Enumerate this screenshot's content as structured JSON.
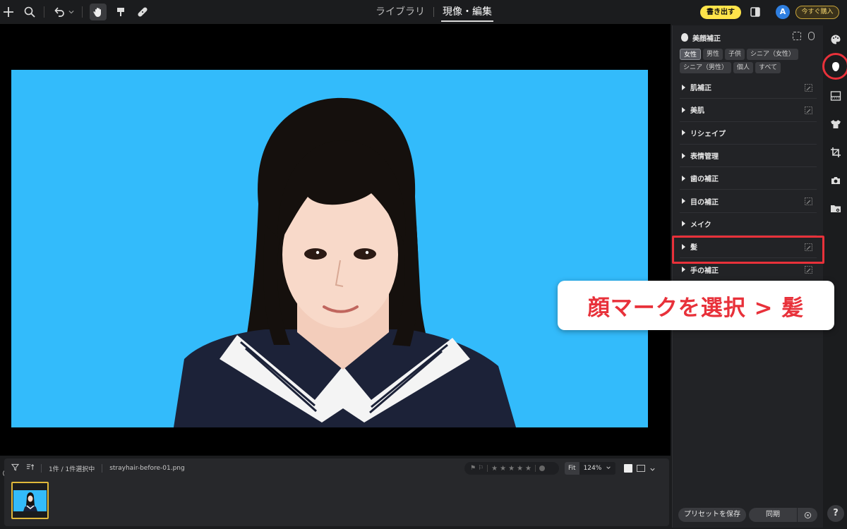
{
  "colors": {
    "accent_yellow": "#ffe44a",
    "highlight_red": "#e8313a",
    "canvas_bg": "#33bbfb",
    "panel_bg": "#222326"
  },
  "topbar": {
    "icons": [
      "plus-icon",
      "search-icon",
      "undo-icon",
      "chevron-down-icon",
      "hand-icon",
      "brush-icon",
      "bandage-icon"
    ],
    "tabs": [
      {
        "label": "ライブラリ"
      },
      {
        "label": "現像・編集"
      }
    ],
    "export_label": "書き出す",
    "avatar_letter": "A",
    "buy_label": "今すぐ購入"
  },
  "panel": {
    "title": "美顔補正",
    "chips": [
      "女性",
      "男性",
      "子供",
      "シニア（女性）",
      "シニア（男性）",
      "個人",
      "すべて"
    ],
    "active_chip": "女性",
    "sections": [
      {
        "label": "肌補正",
        "has_edit": true
      },
      {
        "label": "美肌",
        "has_edit": true
      },
      {
        "label": "リシェイプ",
        "has_edit": false
      },
      {
        "label": "表情管理",
        "has_edit": false
      },
      {
        "label": "歯の補正",
        "has_edit": false
      },
      {
        "label": "目の補正",
        "has_edit": true
      },
      {
        "label": "メイク",
        "has_edit": false
      },
      {
        "label": "髪",
        "has_edit": true
      },
      {
        "label": "手の補正",
        "has_edit": true
      }
    ],
    "footer": {
      "preset_label": "プリセットを保存",
      "sync_label": "同期"
    }
  },
  "filmstrip": {
    "count_text": "1件 / 1件選択中",
    "filename": "strayhair-before-01.png",
    "zoom_fit": "Fit",
    "zoom_value": "124%",
    "rating": 0
  },
  "callout": {
    "text": "顔マークを選択 > 髪"
  },
  "help_label": "?"
}
